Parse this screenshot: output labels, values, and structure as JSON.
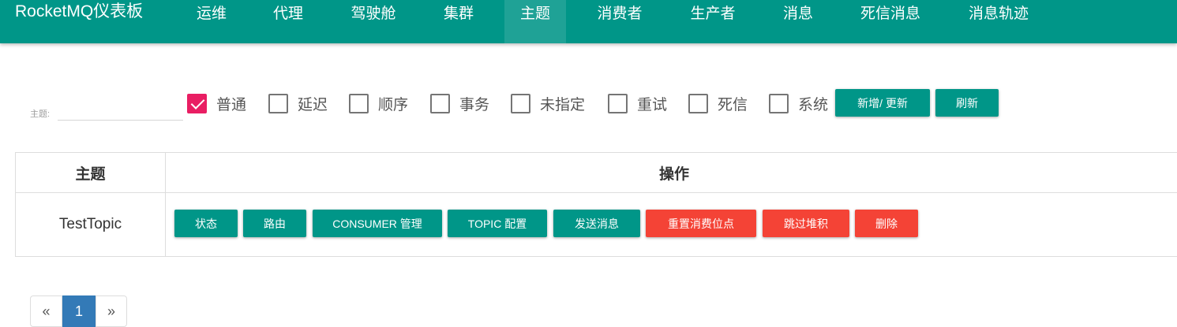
{
  "navbar": {
    "brand": "RocketMQ仪表板",
    "items": [
      {
        "label": "运维"
      },
      {
        "label": "代理"
      },
      {
        "label": "驾驶舱"
      },
      {
        "label": "集群"
      },
      {
        "label": "主题",
        "active": true
      },
      {
        "label": "消费者"
      },
      {
        "label": "生产者"
      },
      {
        "label": "消息"
      },
      {
        "label": "死信消息"
      },
      {
        "label": "消息轨迹"
      }
    ]
  },
  "filter": {
    "label": "主题:",
    "value": "",
    "checkboxes": [
      {
        "label": "普通",
        "checked": true
      },
      {
        "label": "延迟",
        "checked": false
      },
      {
        "label": "顺序",
        "checked": false
      },
      {
        "label": "事务",
        "checked": false
      },
      {
        "label": "未指定",
        "checked": false
      },
      {
        "label": "重试",
        "checked": false
      },
      {
        "label": "死信",
        "checked": false
      },
      {
        "label": "系统",
        "checked": false
      }
    ],
    "add_update_label": "新增/ 更新",
    "refresh_label": "刷新"
  },
  "table": {
    "headers": {
      "topic": "主题",
      "ops": "操作"
    },
    "rows": [
      {
        "topic": "TestTopic",
        "actions": [
          {
            "label": "状态",
            "color": "#009688"
          },
          {
            "label": "路由",
            "color": "#009688"
          },
          {
            "label": "CONSUMER 管理",
            "color": "#009688"
          },
          {
            "label": "TOPIC 配置",
            "color": "#009688"
          },
          {
            "label": "发送消息",
            "color": "#009688"
          },
          {
            "label": "重置消费位点",
            "color": "#f44336"
          },
          {
            "label": "跳过堆积",
            "color": "#f44336"
          },
          {
            "label": "删除",
            "color": "#f44336"
          }
        ]
      }
    ]
  },
  "pagination": {
    "prev": "«",
    "current": "1",
    "next": "»"
  }
}
